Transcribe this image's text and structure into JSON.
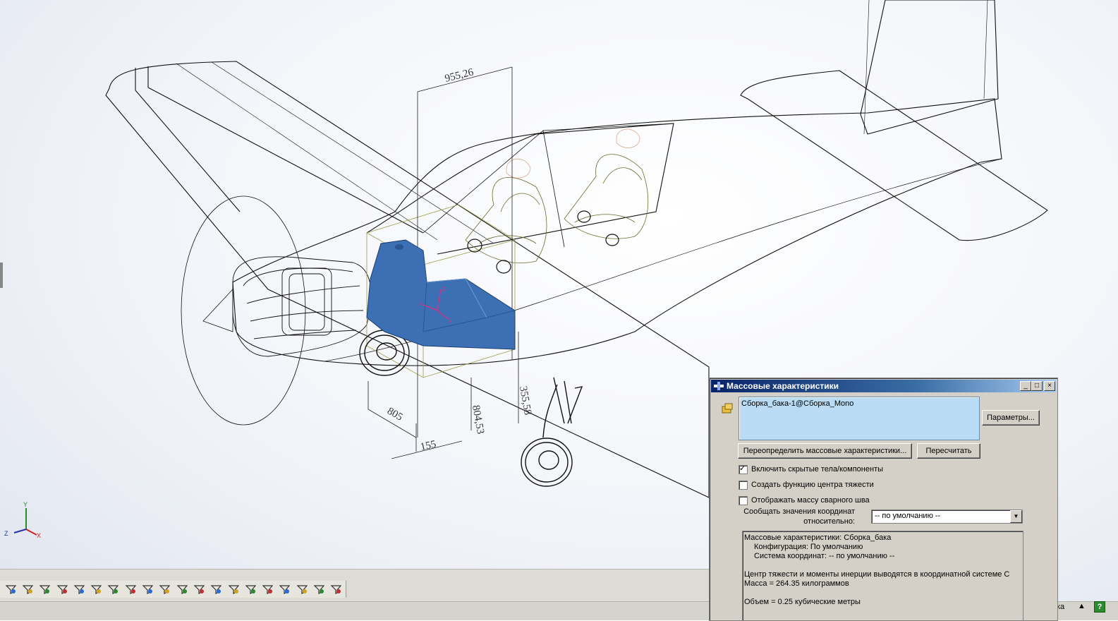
{
  "viewport": {
    "dimensions": [
      "955,26",
      "805",
      "155",
      "804,53",
      "355,58"
    ],
    "triad": {
      "x": "X",
      "y": "Y",
      "z": "Z"
    },
    "origin_labels": {
      "x": "x",
      "y": "y",
      "z": "z"
    }
  },
  "toolbar": {
    "icons": [
      "filter-icon",
      "filter-vertex-icon",
      "filter-edge-icon",
      "filter-face-icon",
      "filter-axis-icon",
      "filter-point-icon",
      "filter-plane-icon",
      "filter-sketch-icon",
      "filter-surface-icon",
      "filter-curve-icon",
      "filter-annotation-icon",
      "filter-dimension-icon",
      "filter-note-icon",
      "filter-datum-icon",
      "filter-weld-icon",
      "filter-hole-icon",
      "filter-tolerance-icon",
      "filter-balloon-icon",
      "filter-symbol-icon",
      "filter-cosmetic-icon"
    ]
  },
  "statusbar": {
    "text": "ка",
    "help": "?"
  },
  "dialog": {
    "title": "Массовые характеристики",
    "selection": "Сборка_бака-1@Сборка_Mono",
    "params_button": "Параметры...",
    "override_button": "Переопределить массовые характеристики...",
    "recalc_button": "Пересчитать",
    "checkboxes": [
      {
        "label": "Включить скрытые тела/компоненты",
        "checked": true
      },
      {
        "label": "Создать функцию центра тяжести",
        "checked": false
      },
      {
        "label": "Отображать массу сварного шва",
        "checked": false
      }
    ],
    "report_label_1": "Сообщать значения координат",
    "report_label_2": "относительно:",
    "coord_value": "-- по умолчанию --",
    "results": [
      "Массовые характеристики: Сборка_бака",
      "    Конфигурация: По умолчанию",
      "    Система координат: -- по умолчанию --",
      "",
      "Центр тяжести и моменты инерции выводятся в координатной системе  С",
      "Масса = 264.35 килограммов",
      "",
      "Объем = 0.25 кубические метры"
    ]
  }
}
